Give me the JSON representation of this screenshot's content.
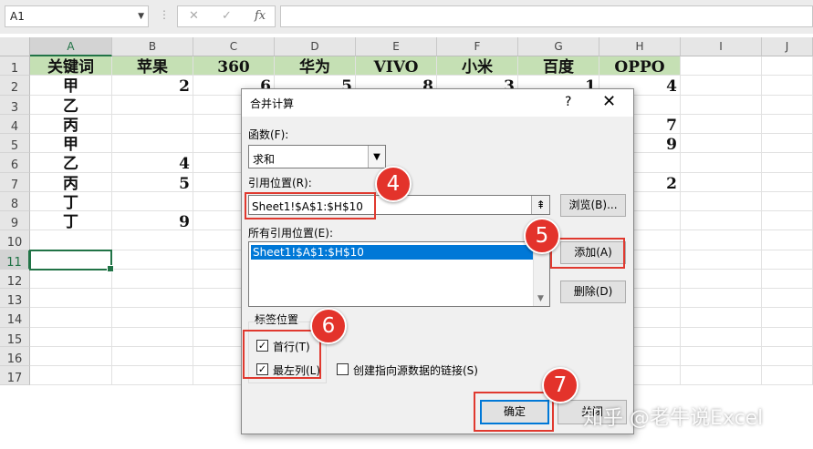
{
  "formula_bar": {
    "name_box": "A1",
    "cancel_icon": "✕",
    "enter_icon": "✓",
    "fx_label": "fx"
  },
  "columns": [
    "A",
    "B",
    "C",
    "D",
    "E",
    "F",
    "G",
    "H",
    "I",
    "J"
  ],
  "rows": [
    "1",
    "2",
    "3",
    "4",
    "5",
    "6",
    "7",
    "8",
    "9",
    "10",
    "11",
    "12",
    "13",
    "14",
    "15",
    "16",
    "17"
  ],
  "header_row": [
    "关键词",
    "苹果",
    "360",
    "华为",
    "VIVO",
    "小米",
    "百度",
    "OPPO"
  ],
  "cells": [
    {
      "ref": "A2",
      "value": "甲"
    },
    {
      "ref": "B2",
      "value": "2"
    },
    {
      "ref": "C2",
      "value": "6"
    },
    {
      "ref": "D2",
      "value": "5"
    },
    {
      "ref": "E2",
      "value": "8"
    },
    {
      "ref": "F2",
      "value": "3"
    },
    {
      "ref": "G2",
      "value": "1"
    },
    {
      "ref": "H2",
      "value": "4"
    },
    {
      "ref": "A3",
      "value": "乙"
    },
    {
      "ref": "A4",
      "value": "丙"
    },
    {
      "ref": "H4",
      "value": "7"
    },
    {
      "ref": "A5",
      "value": "甲"
    },
    {
      "ref": "H5",
      "value": "9"
    },
    {
      "ref": "A6",
      "value": "乙"
    },
    {
      "ref": "B6",
      "value": "4"
    },
    {
      "ref": "A7",
      "value": "丙"
    },
    {
      "ref": "B7",
      "value": "5"
    },
    {
      "ref": "H7",
      "value": "2"
    },
    {
      "ref": "A8",
      "value": "丁"
    },
    {
      "ref": "A9",
      "value": "丁"
    },
    {
      "ref": "B9",
      "value": "9"
    }
  ],
  "selected_cell": "A11",
  "dialog": {
    "title": "合并计算",
    "help": "?",
    "close": "✕",
    "function_label": "函数(F):",
    "function_value": "求和",
    "reference_label": "引用位置(R):",
    "reference_value": "Sheet1!$A$1:$H$10",
    "browse_button": "浏览(B)...",
    "all_refs_label": "所有引用位置(E):",
    "all_refs": [
      "Sheet1!$A$1:$H$10"
    ],
    "add_button": "添加(A)",
    "delete_button": "删除(D)",
    "label_group": "标签位置",
    "top_row": "首行(T)",
    "left_column": "最左列(L)",
    "create_links": "创建指向源数据的链接(S)",
    "ok_button": "确定",
    "cancel_button": "关闭"
  },
  "badges": [
    "4",
    "5",
    "6",
    "7"
  ],
  "watermark": "知乎 @老牛说Excel",
  "colors": {
    "header_fill": "#c5e0b4",
    "badge": "#e3332b",
    "highlight": "#e0392f",
    "accent": "#217346"
  }
}
